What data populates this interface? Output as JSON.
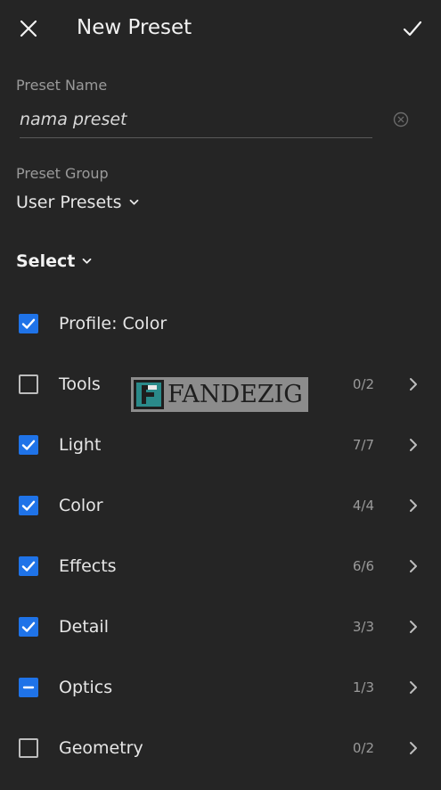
{
  "header": {
    "title": "New Preset",
    "close_icon": "close-icon",
    "confirm_icon": "checkmark-icon"
  },
  "preset_name": {
    "label": "Preset Name",
    "value": "nama preset"
  },
  "preset_group": {
    "label": "Preset Group",
    "value": "User Presets"
  },
  "select": {
    "label": "Select"
  },
  "items": [
    {
      "label": "Profile: Color",
      "state": "checked",
      "count": ""
    },
    {
      "label": "Tools",
      "state": "unchecked",
      "count": "0/2"
    },
    {
      "label": "Light",
      "state": "checked",
      "count": "7/7"
    },
    {
      "label": "Color",
      "state": "checked",
      "count": "4/4"
    },
    {
      "label": "Effects",
      "state": "checked",
      "count": "6/6"
    },
    {
      "label": "Detail",
      "state": "checked",
      "count": "3/3"
    },
    {
      "label": "Optics",
      "state": "partial",
      "count": "1/3"
    },
    {
      "label": "Geometry",
      "state": "unchecked",
      "count": "0/2"
    }
  ],
  "watermark": {
    "text": "FANDEZIG"
  },
  "colors": {
    "background": "#252525",
    "accent": "#1f73e8",
    "text": "#e6e6e6",
    "muted": "#9a9a9a"
  }
}
